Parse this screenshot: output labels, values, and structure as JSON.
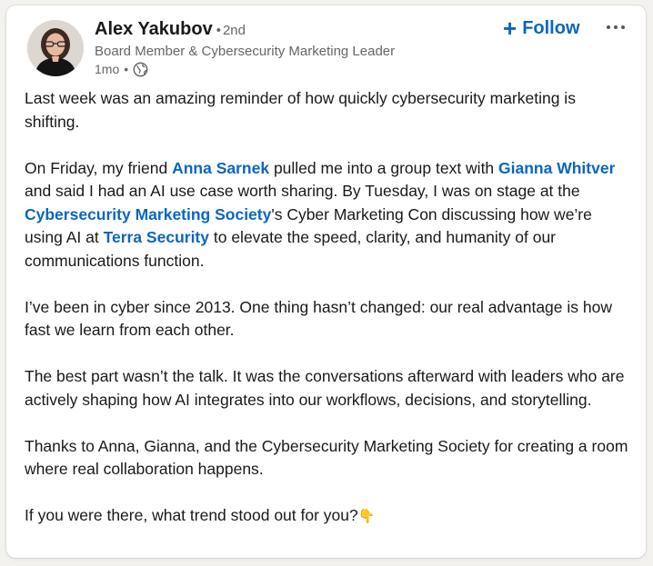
{
  "post": {
    "author": {
      "name": "Alex Yakubov",
      "separator": "•",
      "degree": "2nd",
      "headline": "Board Member & Cybersecurity Marketing Leader",
      "time": "1mo",
      "time_separator": "•",
      "visibility_icon": "globe-icon"
    },
    "follow_label": "Follow",
    "follow_icon": "+",
    "more_icon": "ellipsis-icon",
    "accent_color": "#0a66c2",
    "paragraphs": {
      "p1": "Last week was an amazing reminder of how quickly cybersecurity marketing is shifting.",
      "p2": {
        "t1": "On Friday, my friend ",
        "m1": "Anna Sarnek",
        "t2": " pulled me into a group text with ",
        "m2": "Gianna Whitver",
        "t3": " and said I had an AI use case worth sharing. By Tuesday, I was on stage at the ",
        "m3": "Cybersecurity Marketing Society",
        "t4": "'s Cyber Marketing Con discussing how we’re using AI at ",
        "m4": "Terra Security",
        "t5": " to elevate the speed, clarity, and humanity of our communications function."
      },
      "p3": "I’ve been in cyber since 2013. One thing hasn’t changed: our real advantage is how fast we learn from each other.",
      "p4": "The best part wasn’t the talk. It was the conversations afterward with leaders who are actively shaping how AI integrates into our workflows, decisions, and storytelling.",
      "p5": "Thanks to Anna, Gianna, and the Cybersecurity Marketing Society for creating a room where real collaboration happens.",
      "p6": "If you were there, what trend stood out for you?",
      "p6_emoji": "👇"
    }
  }
}
